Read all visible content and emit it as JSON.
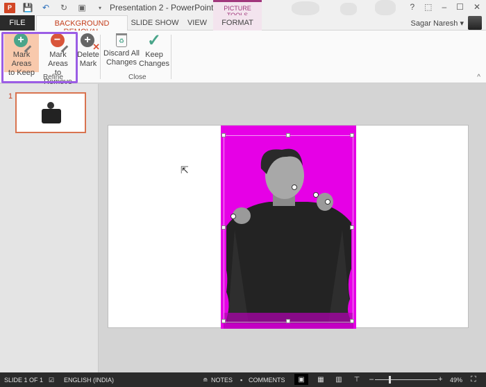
{
  "titlebar": {
    "title": "Presentation 2 - PowerPoint",
    "app_logo": "P",
    "contextual_group": "PICTURE TOOLS",
    "qat": [
      "save-icon",
      "undo-icon",
      "redo-icon",
      "start-from-beginning-icon"
    ],
    "window_controls": {
      "help": "?",
      "ribbon_display": "⬚",
      "minimize": "–",
      "maximize": "☐",
      "close": "✕"
    }
  },
  "tabs": {
    "file": "FILE",
    "background_removal": "BACKGROUND REMOVAL",
    "slide_show": "SLIDE SHOW",
    "view": "VIEW",
    "format": "FORMAT"
  },
  "user": {
    "name": "Sagar Naresh ▾"
  },
  "ribbon": {
    "refine": {
      "label": "Refine",
      "mark_keep": [
        "Mark Areas",
        "to Keep"
      ],
      "mark_remove": [
        "Mark Areas",
        "to Remove"
      ],
      "delete_mark": [
        "Delete",
        "Mark"
      ]
    },
    "close": {
      "label": "Close",
      "discard": [
        "Discard All",
        "Changes"
      ],
      "keep": [
        "Keep",
        "Changes"
      ]
    },
    "collapse": "^"
  },
  "thumbnails": [
    {
      "number": "1"
    }
  ],
  "statusbar": {
    "slide": "SLIDE 1 OF 1",
    "language": "ENGLISH (INDIA)",
    "notes": "NOTES",
    "comments": "COMMENTS",
    "zoom_minus": "–",
    "zoom_plus": "+",
    "zoom_level": "49%"
  },
  "colors": {
    "accent": "#c43e1c",
    "removal_overlay": "#e600e6",
    "highlight": "#9b5de5"
  }
}
